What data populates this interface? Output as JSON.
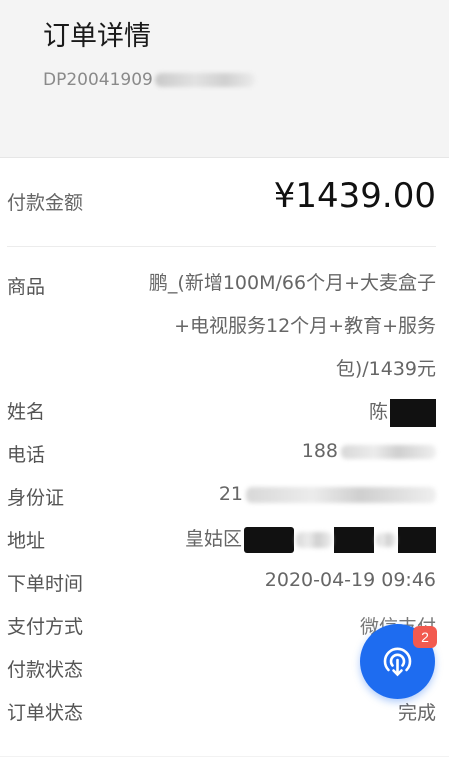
{
  "header": {
    "title": "订单详情",
    "order_no_prefix": "DP20041909"
  },
  "payment": {
    "label": "付款金额",
    "amount": "¥1439.00"
  },
  "details": {
    "goods": {
      "label": "商品",
      "line1": "鹏_(新增100M/66个月+大麦盒子",
      "line2": "+电视服务12个月+教育+服务",
      "line3": "包)/1439元"
    },
    "name": {
      "label": "姓名",
      "value_prefix": "陈"
    },
    "phone": {
      "label": "电话",
      "value_prefix": "188"
    },
    "id_card": {
      "label": "身份证",
      "value_prefix": "21"
    },
    "address": {
      "label": "地址",
      "value_prefix": "皇姑区"
    },
    "order_time": {
      "label": "下单时间",
      "value": "2020-04-19 09:46"
    },
    "pay_method": {
      "label": "支付方式",
      "value": "微信支付"
    },
    "pay_status": {
      "label": "付款状态",
      "value": ""
    },
    "order_status": {
      "label": "订单状态",
      "value": "完成"
    }
  },
  "fab": {
    "icon": "broadcast-download-icon",
    "badge_count": "2",
    "color": "#1e6cf0",
    "badge_color": "#f25a4f"
  }
}
